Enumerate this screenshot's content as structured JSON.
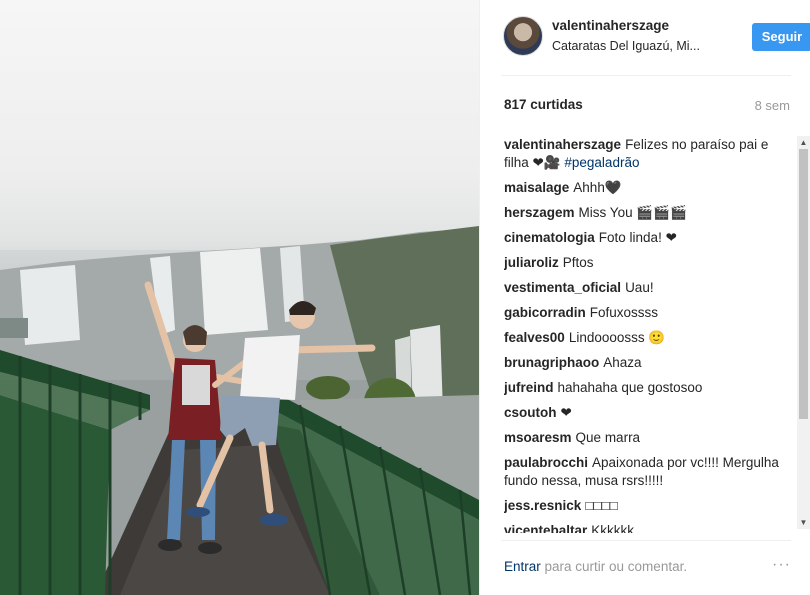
{
  "post": {
    "username": "valentinaherszage",
    "location": "Cataratas Del Iguazú, Mi...",
    "follow_label": "Seguir",
    "likes": "817 curtidas",
    "time_ago": "8 sem",
    "caption_user": "valentinaherszage",
    "caption_text": "Felizes no paraíso pai e filha ❤🎥 ",
    "caption_hashtag": "#pegaladrão"
  },
  "comments": [
    {
      "user": "maisalage",
      "text": "Ahhh🖤"
    },
    {
      "user": "herszagem",
      "text": "Miss You 🎬🎬🎬"
    },
    {
      "user": "cinematologia",
      "text": "Foto linda! ❤"
    },
    {
      "user": "juliaroliz",
      "text": "Pftos"
    },
    {
      "user": "vestimenta_oficial",
      "text": "Uau!"
    },
    {
      "user": "gabicorradin",
      "text": "Fofuxossss"
    },
    {
      "user": "fealves00",
      "text": "Lindoooosss 🙂"
    },
    {
      "user": "brunagriphaoo",
      "text": "Ahaza"
    },
    {
      "user": "jufreind",
      "text": "hahahaha que gostosoo"
    },
    {
      "user": "csoutoh",
      "text": "❤"
    },
    {
      "user": "msoaresm",
      "text": "Que marra"
    },
    {
      "user": "paulabrocchi",
      "text": "Apaixonada por vc!!!! Mergulha fundo nessa, musa rsrs!!!!!"
    },
    {
      "user": "jess.resnick",
      "text": "□□□□"
    },
    {
      "user": "vicentebaltar",
      "text": "Kkkkkk"
    }
  ],
  "footer": {
    "login_link": "Entrar",
    "login_text": " para curtir ou comentar.",
    "more_icon": "···"
  },
  "icons": {
    "scroll_up": "▲",
    "scroll_down": "▼"
  },
  "colors": {
    "accent": "#3897f0",
    "link": "#003569",
    "muted": "#999999"
  }
}
